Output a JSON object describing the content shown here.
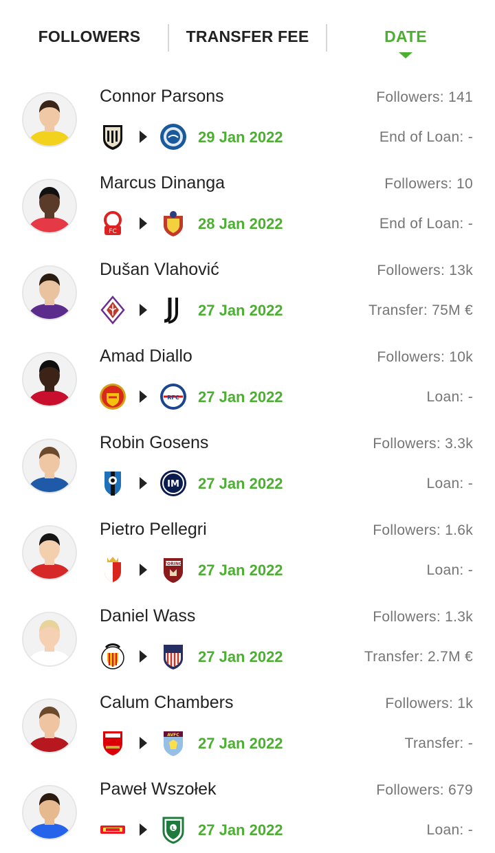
{
  "tabs": [
    {
      "label": "FOLLOWERS",
      "active": false
    },
    {
      "label": "TRANSFER FEE",
      "active": false
    },
    {
      "label": "DATE",
      "active": true
    }
  ],
  "colors": {
    "accent": "#4caf32",
    "muted": "#757575",
    "text": "#222222"
  },
  "transfers": [
    {
      "name": "Connor Parsons",
      "followers": "Followers: 141",
      "date": "29 Jan 2022",
      "fee": "End of Loan: -",
      "from_crest": "notts-county-crest",
      "to_crest": "wycombe-crest",
      "avatar": "connor-parsons-avatar"
    },
    {
      "name": "Marcus Dinanga",
      "followers": "Followers: 10",
      "date": "28 Jan 2022",
      "fee": "End of Loan: -",
      "from_crest": "kidderminster-crest",
      "to_crest": "altrincham-crest",
      "avatar": "marcus-dinanga-avatar"
    },
    {
      "name": "Dušan Vlahović",
      "followers": "Followers: 13k",
      "date": "27 Jan 2022",
      "fee": "Transfer: 75M €",
      "from_crest": "fiorentina-crest",
      "to_crest": "juventus-crest",
      "avatar": "dusan-vlahovic-avatar"
    },
    {
      "name": "Amad Diallo",
      "followers": "Followers: 10k",
      "date": "27 Jan 2022",
      "fee": "Loan: -",
      "from_crest": "manchester-united-crest",
      "to_crest": "rangers-crest",
      "avatar": "amad-diallo-avatar"
    },
    {
      "name": "Robin Gosens",
      "followers": "Followers: 3.3k",
      "date": "27 Jan 2022",
      "fee": "Loan: -",
      "from_crest": "atalanta-crest",
      "to_crest": "inter-crest",
      "avatar": "robin-gosens-avatar"
    },
    {
      "name": "Pietro Pellegri",
      "followers": "Followers: 1.6k",
      "date": "27 Jan 2022",
      "fee": "Loan: -",
      "from_crest": "monaco-crest",
      "to_crest": "torino-crest",
      "avatar": "pietro-pellegri-avatar"
    },
    {
      "name": "Daniel Wass",
      "followers": "Followers: 1.3k",
      "date": "27 Jan 2022",
      "fee": "Transfer: 2.7M €",
      "from_crest": "valencia-crest",
      "to_crest": "atletico-madrid-crest",
      "avatar": "daniel-wass-avatar"
    },
    {
      "name": "Calum Chambers",
      "followers": "Followers: 1k",
      "date": "27 Jan 2022",
      "fee": "Transfer: -",
      "from_crest": "arsenal-crest",
      "to_crest": "aston-villa-crest",
      "avatar": "calum-chambers-avatar"
    },
    {
      "name": "Paweł Wszołek",
      "followers": "Followers: 679",
      "date": "27 Jan 2022",
      "fee": "Loan: -",
      "from_crest": "union-berlin-crest",
      "to_crest": "legia-warsaw-crest",
      "avatar": "pawel-wszolek-avatar"
    }
  ]
}
